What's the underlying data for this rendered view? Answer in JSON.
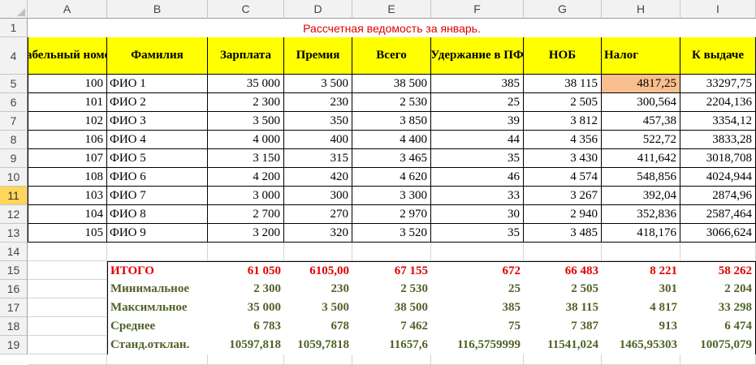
{
  "columns": [
    "A",
    "B",
    "C",
    "D",
    "E",
    "F",
    "G",
    "H",
    "I"
  ],
  "rows": [
    "1",
    "4",
    "5",
    "6",
    "7",
    "8",
    "9",
    "10",
    "11",
    "12",
    "13",
    "14",
    "15",
    "16",
    "17",
    "18",
    "19"
  ],
  "selected_row": "11",
  "title": "Рассчетная ведомость за январь.",
  "headers": [
    "Табельный номер",
    "Фамилия",
    "Зарплата",
    "Премия",
    "Всего",
    "Удержание в ПФ",
    "НОБ",
    "Налог",
    "К выдаче"
  ],
  "employees": [
    [
      "100",
      "ФИО 1",
      "35 000",
      "3 500",
      "38 500",
      "385",
      "38 115",
      "4817,25",
      "33297,75"
    ],
    [
      "101",
      "ФИО 2",
      "2 300",
      "230",
      "2 530",
      "25",
      "2 505",
      "300,564",
      "2204,136"
    ],
    [
      "102",
      "ФИО 3",
      "3 500",
      "350",
      "3 850",
      "39",
      "3 812",
      "457,38",
      "3354,12"
    ],
    [
      "106",
      "ФИО 4",
      "4 000",
      "400",
      "4 400",
      "44",
      "4 356",
      "522,72",
      "3833,28"
    ],
    [
      "107",
      "ФИО 5",
      "3 150",
      "315",
      "3 465",
      "35",
      "3 430",
      "411,642",
      "3018,708"
    ],
    [
      "108",
      "ФИО 6",
      "4 200",
      "420",
      "4 620",
      "46",
      "4 574",
      "548,856",
      "4024,944"
    ],
    [
      "103",
      "ФИО 7",
      "3 000",
      "300",
      "3 300",
      "33",
      "3 267",
      "392,04",
      "2874,96"
    ],
    [
      "104",
      "ФИО 8",
      "2 700",
      "270",
      "2 970",
      "30",
      "2 940",
      "352,836",
      "2587,464"
    ],
    [
      "105",
      "ФИО 9",
      "3 200",
      "320",
      "3 520",
      "35",
      "3 485",
      "418,176",
      "3066,624"
    ]
  ],
  "summary": [
    {
      "label": "ИТОГО",
      "values": [
        "61 050",
        "6105,00",
        "67 155",
        "672",
        "66 483",
        "8 221",
        "58 262"
      ]
    },
    {
      "label": "Минимальное",
      "values": [
        "2 300",
        "230",
        "2 530",
        "25",
        "2 505",
        "301",
        "2 204"
      ]
    },
    {
      "label": "Максимльное",
      "values": [
        "35 000",
        "3 500",
        "38 500",
        "385",
        "38 115",
        "4 817",
        "33 298"
      ]
    },
    {
      "label": "Среднее",
      "values": [
        "6 783",
        "678",
        "7 462",
        "75",
        "7 387",
        "913",
        "6 474"
      ]
    },
    {
      "label": "Станд.отклан.",
      "values": [
        "10597,818",
        "1059,7818",
        "11657,6",
        "116,5759999",
        "11541,024",
        "1465,95303",
        "10075,079"
      ]
    }
  ],
  "colors": {
    "header_fill": "#ffff00",
    "highlight_fill": "#fabf8f",
    "title": "#e00000",
    "total": "#e00000",
    "stats": "#4f6228",
    "selected_row": "#ffd55a"
  }
}
